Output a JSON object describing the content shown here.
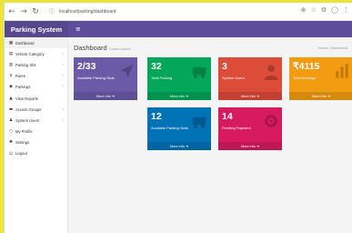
{
  "browser": {
    "url": "localhost/parking/dashboard",
    "back_icon": "back-arrow-icon",
    "forward_icon": "forward-arrow-icon",
    "reload_icon": "reload-icon"
  },
  "header": {
    "brand": "Parking System",
    "menu_icon": "hamburger-icon"
  },
  "sidebar": {
    "items": [
      {
        "label": "Dashboard",
        "icon": "dashboard-icon",
        "arrow": false
      },
      {
        "label": "Vehicle Category",
        "icon": "car-icon",
        "arrow": true
      },
      {
        "label": "Parking Slot",
        "icon": "slot-icon",
        "arrow": true
      },
      {
        "label": "Rates",
        "icon": "rate-icon",
        "arrow": true
      },
      {
        "label": "Parkings",
        "icon": "parking-icon",
        "arrow": true
      },
      {
        "label": "View Reports",
        "icon": "report-icon",
        "arrow": false
      },
      {
        "label": "Access Groups",
        "icon": "group-icon",
        "arrow": true
      },
      {
        "label": "System Users",
        "icon": "users-icon",
        "arrow": true
      },
      {
        "label": "My Profile",
        "icon": "profile-icon",
        "arrow": false
      },
      {
        "label": "Settings",
        "icon": "settings-icon",
        "arrow": false
      },
      {
        "label": "Logout",
        "icon": "logout-icon",
        "arrow": false
      }
    ]
  },
  "main": {
    "title": "Dashboard",
    "subtitle": "Control panel",
    "breadcrumb": "Home › Dashboard",
    "boxes": [
      {
        "value": "2/33",
        "label": "Available Parking Slots",
        "footer": "More info",
        "color": "#6a5aa8",
        "icon": "send-icon"
      },
      {
        "value": "32",
        "label": "Total Parking",
        "footer": "More info",
        "color": "#04a65a",
        "icon": "car-icon"
      },
      {
        "value": "3",
        "label": "System Users",
        "footer": "More info",
        "color": "#dd4b39",
        "icon": "user-icon"
      },
      {
        "value": "₹4115",
        "label": "Total Earnings",
        "footer": "More info",
        "color": "#f39c12",
        "icon": "bar-chart-icon"
      },
      {
        "value": "12",
        "label": "Available Parking Slots",
        "footer": "More info",
        "color": "#0073b7",
        "icon": "car-icon"
      },
      {
        "value": "14",
        "label": "Pending Payment",
        "footer": "More info",
        "color": "#d81b60",
        "icon": "gear-icon"
      }
    ]
  }
}
